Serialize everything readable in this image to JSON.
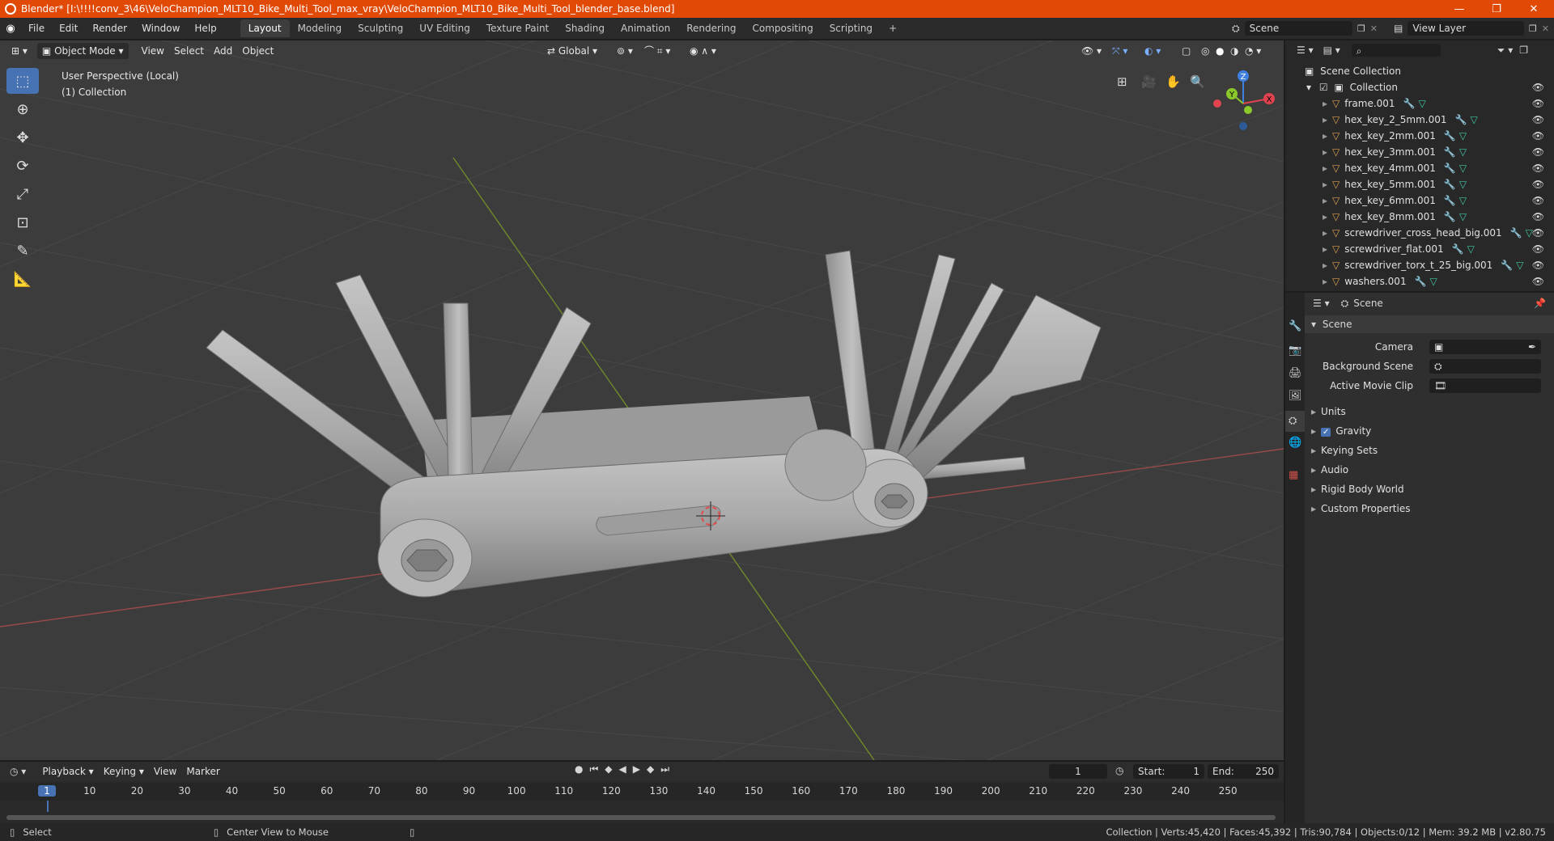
{
  "titlebar": {
    "title": "Blender* [I:\\!!!!conv_3\\46\\VeloChampion_MLT10_Bike_Multi_Tool_max_vray\\VeloChampion_MLT10_Bike_Multi_Tool_blender_base.blend]",
    "minimize": "—",
    "maximize": "❐",
    "close": "✕"
  },
  "menus": [
    "File",
    "Edit",
    "Render",
    "Window",
    "Help"
  ],
  "workspaces": [
    "Layout",
    "Modeling",
    "Sculpting",
    "UV Editing",
    "Texture Paint",
    "Shading",
    "Animation",
    "Rendering",
    "Compositing",
    "Scripting"
  ],
  "active_workspace": "Layout",
  "add_workspace": "+",
  "scene_field": "Scene",
  "view_layer_field": "View Layer",
  "viewport": {
    "mode": "Object Mode",
    "menus": [
      "View",
      "Select",
      "Add",
      "Object"
    ],
    "transform_orientation": "Global",
    "info_line1": "User Perspective (Local)",
    "info_line2": "(1) Collection",
    "gizmo": {
      "x": "X",
      "y": "Y",
      "z": "Z"
    }
  },
  "outliner": {
    "root": "Scene Collection",
    "collection": "Collection",
    "items": [
      "frame.001",
      "hex_key_2_5mm.001",
      "hex_key_2mm.001",
      "hex_key_3mm.001",
      "hex_key_4mm.001",
      "hex_key_5mm.001",
      "hex_key_6mm.001",
      "hex_key_8mm.001",
      "screwdriver_cross_head_big.001",
      "screwdriver_flat.001",
      "screwdriver_torx_t_25_big.001",
      "washers.001"
    ]
  },
  "properties": {
    "context": "Scene",
    "panel": "Scene",
    "fields": [
      "Camera",
      "Background Scene",
      "Active Movie Clip"
    ],
    "sections": [
      "Units",
      "Gravity",
      "Keying Sets",
      "Audio",
      "Rigid Body World",
      "Custom Properties"
    ],
    "gravity_checked": true
  },
  "timeline": {
    "menus": [
      "Playback",
      "Keying",
      "View",
      "Marker"
    ],
    "current_frame": "1",
    "start_label": "Start:",
    "start": "1",
    "end_label": "End:",
    "end": "250",
    "ruler": [
      "1",
      "10",
      "20",
      "30",
      "40",
      "50",
      "60",
      "70",
      "80",
      "90",
      "100",
      "110",
      "120",
      "130",
      "140",
      "150",
      "160",
      "170",
      "180",
      "190",
      "200",
      "210",
      "220",
      "230",
      "240",
      "250"
    ]
  },
  "statusbar": {
    "left1": "Select",
    "left2": "Center View to Mouse",
    "stats": "Collection | Verts:45,420 | Faces:45,392 | Tris:90,784 | Objects:0/12 | Mem: 39.2 MB | v2.80.75"
  },
  "colors": {
    "titlebar": "#e04a06",
    "accent": "#4772b3",
    "mesh_icon": "#e0a050",
    "modifier_icon": "#6fa8ff",
    "data_icon": "#3fc9a6",
    "x_axis": "#e0424f",
    "y_axis": "#8bc82a",
    "z_axis": "#3f7fe0"
  }
}
